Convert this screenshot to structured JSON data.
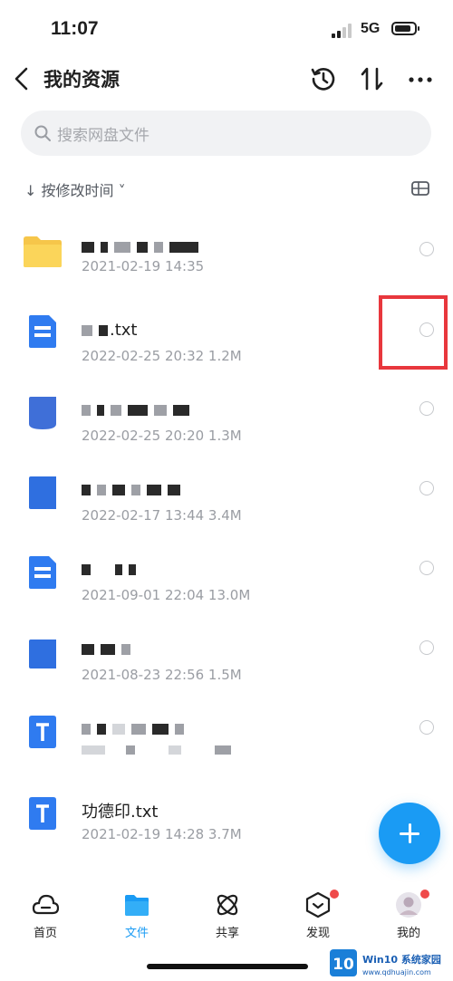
{
  "status_bar": {
    "time": "11:07",
    "network": "5G"
  },
  "header": {
    "title": "我的资源"
  },
  "search": {
    "placeholder": "搜索网盘文件"
  },
  "sort": {
    "label": "↓ 按修改时间 ˅"
  },
  "files": [
    {
      "type": "folder",
      "name": "",
      "meta": "2021-02-19 14:35"
    },
    {
      "type": "doc",
      "name": ".txt",
      "meta": "2022-02-25 20:32   1.2M"
    },
    {
      "type": "doc",
      "name": "",
      "meta": "2022-02-25 20:20   1.3M"
    },
    {
      "type": "doc",
      "name": "",
      "meta": "2022-02-17 13:44   3.4M"
    },
    {
      "type": "doc",
      "name": "",
      "meta": "2021-09-01 22:04   13.0M"
    },
    {
      "type": "doc",
      "name": "",
      "meta": "2021-08-23 22:56   1.5M"
    },
    {
      "type": "txt",
      "name": "",
      "meta": ""
    },
    {
      "type": "txt",
      "name": "功德印.txt",
      "meta": "2021-02-19 14:28   3.7M"
    }
  ],
  "tabs": [
    {
      "label": "首页",
      "icon": "cloud-icon",
      "active": false
    },
    {
      "label": "文件",
      "icon": "folder-icon",
      "active": true
    },
    {
      "label": "共享",
      "icon": "share-icon",
      "active": false
    },
    {
      "label": "发现",
      "icon": "discover-icon",
      "active": false
    },
    {
      "label": "我的",
      "icon": "avatar",
      "active": false
    }
  ],
  "watermark": {
    "number": "10",
    "brand": "Win10 系统家园",
    "url": "www.qdhuajin.com"
  },
  "colors": {
    "accent": "#1a9bf4",
    "folder": "#f6c64a",
    "doc": "#2f7bf0",
    "badge": "#ef4a4a",
    "highlight": "#e8373d"
  }
}
